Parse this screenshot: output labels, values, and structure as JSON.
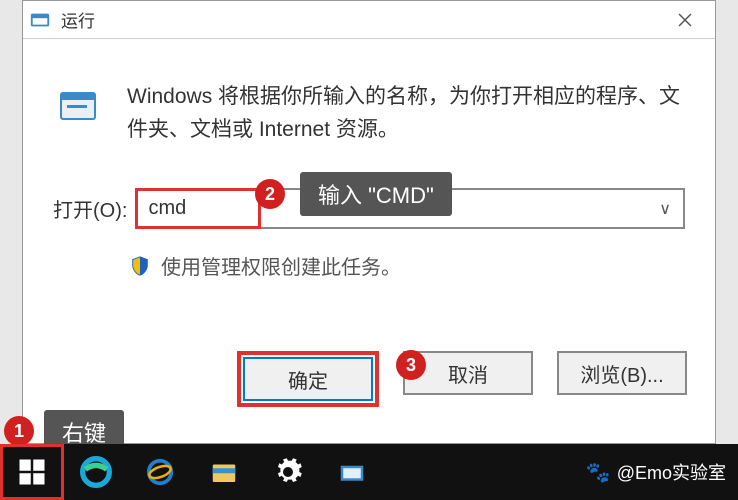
{
  "dialog": {
    "title": "运行",
    "description": "Windows 将根据你所输入的名称，为你打开相应的程序、文件夹、文档或 Internet 资源。",
    "open_label": "打开(O):",
    "input_value": "cmd",
    "admin_text": "使用管理权限创建此任务。",
    "buttons": {
      "ok": "确定",
      "cancel": "取消",
      "browse": "浏览(B)..."
    }
  },
  "annotations": {
    "step1": {
      "num": "1",
      "text": "右键"
    },
    "step2": {
      "num": "2",
      "text": "输入 \"CMD\""
    },
    "step3": {
      "num": "3"
    }
  },
  "watermark": "@Emo实验室"
}
